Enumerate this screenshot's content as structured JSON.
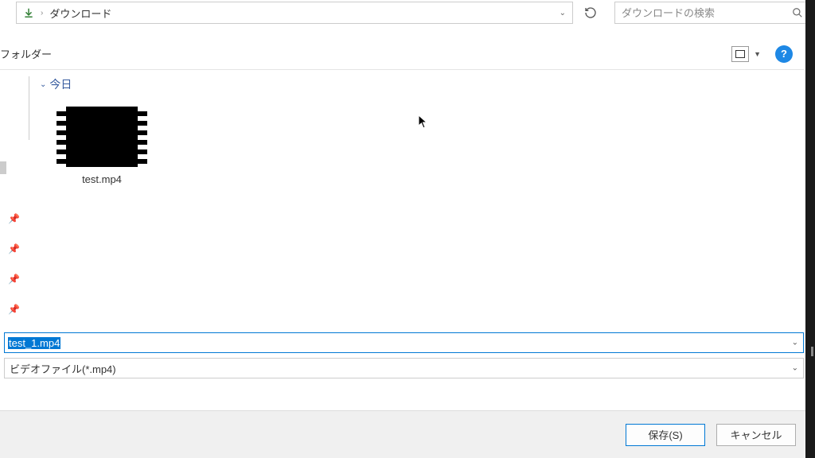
{
  "addressbar": {
    "location": "ダウンロード"
  },
  "search": {
    "placeholder": "ダウンロードの検索"
  },
  "toolbar": {
    "folder_label": "フォルダー"
  },
  "group": {
    "label": "今日"
  },
  "files": [
    {
      "name": "test.mp4"
    }
  ],
  "filename": {
    "value": "test_1.mp4"
  },
  "filetype": {
    "label": "ビデオファイル(*.mp4)"
  },
  "buttons": {
    "save": "保存(S)",
    "cancel": "キャンセル"
  }
}
